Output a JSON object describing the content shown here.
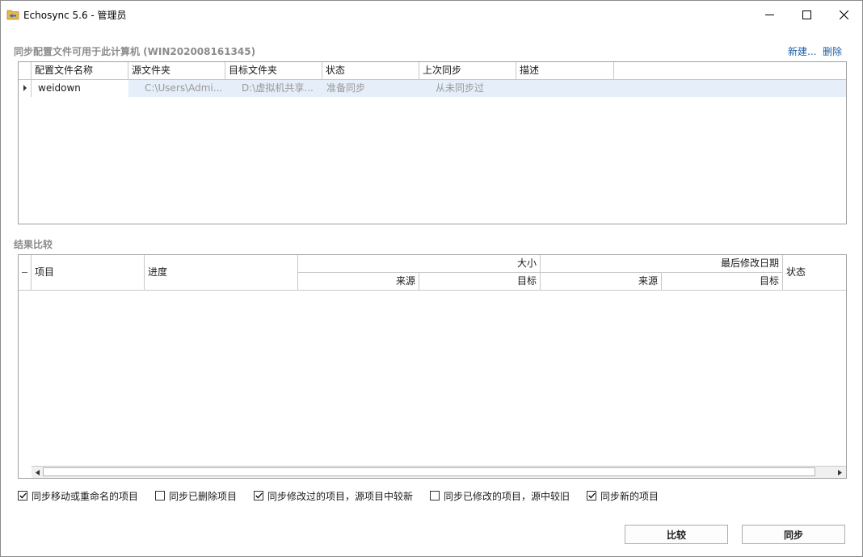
{
  "window": {
    "title": "Echosync 5.6 - 管理员"
  },
  "profiles": {
    "header": "同步配置文件可用于此计算机 (WIN202008161345)",
    "new_link": "新建...",
    "delete_link": "删除",
    "columns": [
      "配置文件名称",
      "源文件夹",
      "目标文件夹",
      "状态",
      "上次同步",
      "描述"
    ],
    "rows": [
      {
        "name": "weidown",
        "source": "C:\\Users\\Admi...",
        "target": "D:\\虚拟机共享...",
        "status": "准备同步",
        "last_sync": "从未同步过",
        "description": ""
      }
    ]
  },
  "results": {
    "header": "结果比较",
    "col_item": "项目",
    "col_progress": "进度",
    "col_size": "大小",
    "col_modified": "最后修改日期",
    "col_status": "状态",
    "sub_source": "来源",
    "sub_target": "目标"
  },
  "options": [
    {
      "label": "同步移动或重命名的项目",
      "checked": true
    },
    {
      "label": "同步已删除项目",
      "checked": false
    },
    {
      "label": "同步修改过的项目，源项目中较新",
      "checked": true
    },
    {
      "label": "同步已修改的项目，源中较旧",
      "checked": false
    },
    {
      "label": "同步新的项目",
      "checked": true
    }
  ],
  "buttons": {
    "compare": "比较",
    "sync": "同步"
  }
}
